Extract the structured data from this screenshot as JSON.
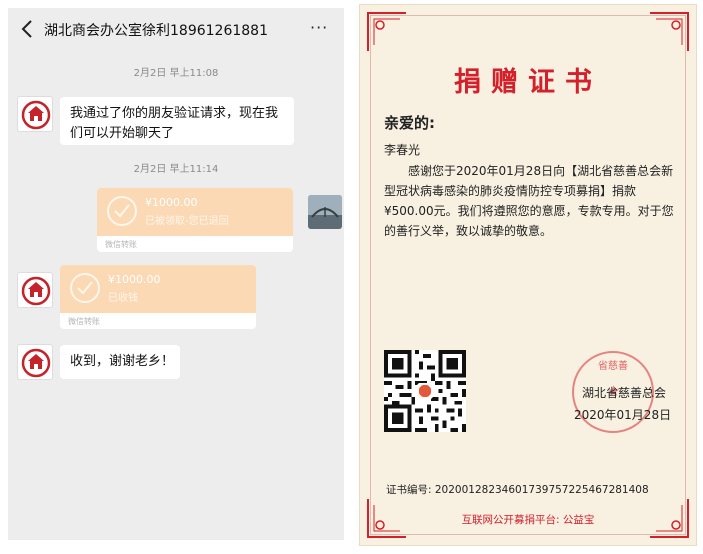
{
  "chat": {
    "title": "湖北商会办公室徐利18961261881",
    "more_label": "···",
    "messages": [
      {
        "time": "2月2日 早上11:08"
      },
      {
        "text": "我通过了你的朋友验证请求，现在我们可以开始聊天了"
      },
      {
        "time": "2月2日 早上11:14"
      },
      {
        "amount": "¥1000.00",
        "status": "已被领取-您已退回",
        "footer": "微信转账"
      },
      {
        "amount": "¥1000.00",
        "status": "已收钱",
        "footer": "微信转账"
      },
      {
        "text": "收到，谢谢老乡！"
      }
    ]
  },
  "certificate": {
    "title": "捐赠证书",
    "salutation": "亲爱的:",
    "recipient": "李春光",
    "body": "感谢您于2020年01月28日向【湖北省慈善总会新型冠状病毒感染的肺炎疫情防控专项募捐】捐款¥500.00元。我们将遵照您的意愿，专款专用。对于您的善行义举，致以诚挚的敬意。",
    "stamp_text": "省慈善",
    "issuer": "湖北省慈善总会",
    "issue_date": "2020年01月28日",
    "certificate_no": "证书编号: 20200128234601739757225467281408",
    "platform": "互联网公开募捐平台:  公益宝"
  },
  "colors": {
    "chat_bg": "#ededed",
    "transfer_orange": "#fbd9b4",
    "cert_red": "#d3202a",
    "cert_bg": "#f8f1e2"
  },
  "icons": [
    "back-arrow-icon",
    "more-dots-icon",
    "association-logo-icon",
    "check-circle-icon",
    "qr-code-icon",
    "seal-stamp-icon"
  ]
}
